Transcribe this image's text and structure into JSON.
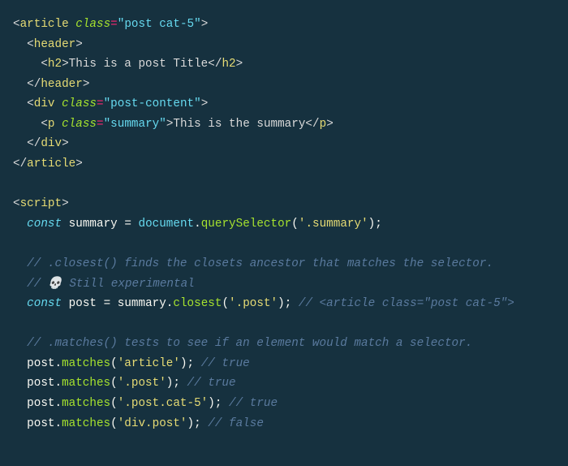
{
  "lines": {
    "l1": {
      "a": "<",
      "b": "article",
      "c": " ",
      "d": "class",
      "e": "=",
      "f": "\"post cat-5\"",
      "g": ">"
    },
    "l2": {
      "a": "  <",
      "b": "header",
      "c": ">"
    },
    "l3": {
      "a": "    <",
      "b": "h2",
      "c": ">",
      "d": "This is a post Title",
      "e": "</",
      "f": "h2",
      "g": ">"
    },
    "l4": {
      "a": "  </",
      "b": "header",
      "c": ">"
    },
    "l5": {
      "a": "  <",
      "b": "div",
      "c": " ",
      "d": "class",
      "e": "=",
      "f": "\"post-content\"",
      "g": ">"
    },
    "l6": {
      "a": "    <",
      "b": "p",
      "c": " ",
      "d": "class",
      "e": "=",
      "f": "\"summary\"",
      "g": ">",
      "h": "This is the summary",
      "i": "</",
      "j": "p",
      "k": ">"
    },
    "l7": {
      "a": "  </",
      "b": "div",
      "c": ">"
    },
    "l8": {
      "a": "</",
      "b": "article",
      "c": ">"
    },
    "l10": {
      "a": "<",
      "b": "script",
      "c": ">"
    },
    "l11": {
      "a": "  ",
      "b": "const",
      "c": " ",
      "d": "summary",
      "e": " = ",
      "f": "document",
      "g": ".",
      "h": "querySelector",
      "i": "(",
      "j": "'.summary'",
      "k": ");"
    },
    "l13": {
      "a": "  ",
      "b": "// .closest() finds the closets ancestor that matches the selector."
    },
    "l14": {
      "a": "  ",
      "b": "// ",
      "c": "💀",
      "d": " Still experimental"
    },
    "l15": {
      "a": "  ",
      "b": "const",
      "c": " ",
      "d": "post",
      "e": " = ",
      "f": "summary.",
      "g": "closest",
      "h": "(",
      "i": "'.post'",
      "j": "); ",
      "k": "// <article class=\"post cat-5\">"
    },
    "l17": {
      "a": "  ",
      "b": "// .matches() tests to see if an element would match a selector."
    },
    "l18": {
      "a": "  post.",
      "b": "matches",
      "c": "(",
      "d": "'article'",
      "e": "); ",
      "f": "// true"
    },
    "l19": {
      "a": "  post.",
      "b": "matches",
      "c": "(",
      "d": "'.post'",
      "e": "); ",
      "f": "// true"
    },
    "l20": {
      "a": "  post.",
      "b": "matches",
      "c": "(",
      "d": "'.post.cat-5'",
      "e": "); ",
      "f": "// true"
    },
    "l21": {
      "a": "  post.",
      "b": "matches",
      "c": "(",
      "d": "'div.post'",
      "e": "); ",
      "f": "// false"
    }
  }
}
